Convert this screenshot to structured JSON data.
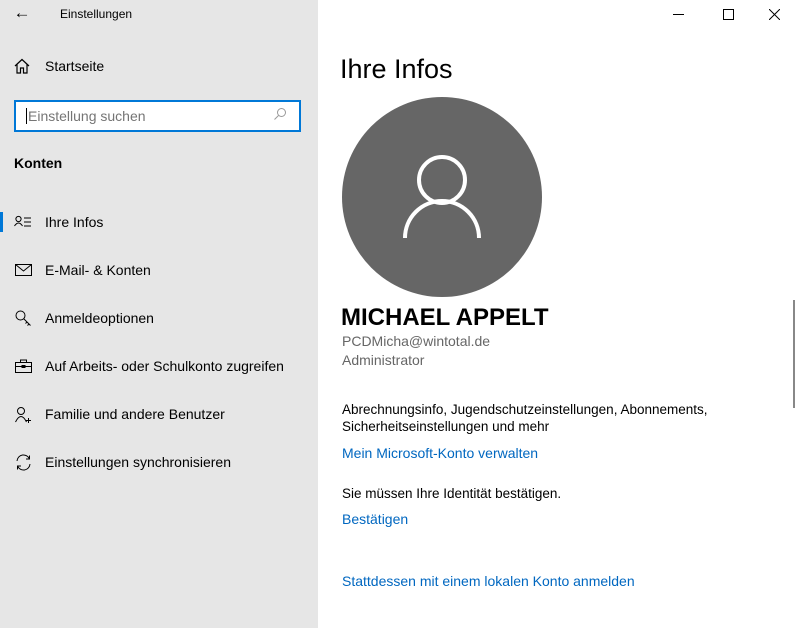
{
  "window": {
    "title": "Einstellungen",
    "minimize": "minimize",
    "maximize": "maximize",
    "close": "close"
  },
  "sidebar": {
    "home": "Startseite",
    "search_placeholder": "Einstellung suchen",
    "section": "Konten",
    "items": [
      {
        "label": "Ihre Infos",
        "icon": "contact-info-icon",
        "active": true
      },
      {
        "label": "E-Mail- & Konten",
        "icon": "mail-icon"
      },
      {
        "label": "Anmeldeoptionen",
        "icon": "key-icon"
      },
      {
        "label": "Auf Arbeits- oder Schulkonto zugreifen",
        "icon": "briefcase-icon"
      },
      {
        "label": "Familie und andere Benutzer",
        "icon": "add-person-icon"
      },
      {
        "label": "Einstellungen synchronisieren",
        "icon": "sync-icon"
      }
    ]
  },
  "main": {
    "title": "Ihre Infos",
    "user_name": "MICHAEL APPELT",
    "email": "PCDMicha@wintotal.de",
    "role": "Administrator",
    "description": "Abrechnungsinfo, Jugendschutzeinstellungen, Abonnements, Sicherheitseinstellungen und mehr",
    "manage_link": "Mein Microsoft-Konto verwalten",
    "verify_text": "Sie müssen Ihre Identität bestätigen.",
    "verify_link": "Bestätigen",
    "local_link": "Stattdessen mit einem lokalen Konto anmelden"
  },
  "colors": {
    "accent": "#0078d7",
    "link": "#0067c0",
    "sidebar_bg": "#e6e6e6",
    "avatar": "#666666"
  }
}
